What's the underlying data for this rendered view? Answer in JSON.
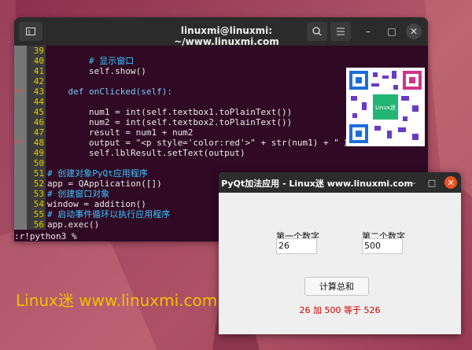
{
  "terminal": {
    "title": "linuxmi@linuxmi: ~/www.linuxmi.com",
    "lines": [
      {
        "num": "39",
        "text": "",
        "mark": ""
      },
      {
        "num": "40",
        "text": "        # 显示窗口",
        "mark": ""
      },
      {
        "num": "41",
        "text": "        self.show()",
        "mark": ""
      },
      {
        "num": "42",
        "text": "",
        "mark": ""
      },
      {
        "num": "43",
        "text": "    def onClicked(self):",
        "mark": ">>"
      },
      {
        "num": "44",
        "text": "",
        "mark": ""
      },
      {
        "num": "45",
        "text": "        num1 = int(self.textbox1.toPlainText())",
        "mark": ""
      },
      {
        "num": "46",
        "text": "        num2 = int(self.textbox2.toPlainText())",
        "mark": ""
      },
      {
        "num": "47",
        "text": "        result = num1 + num2",
        "mark": ""
      },
      {
        "num": "48",
        "text": "        output = \"<p style='color:red'>\" + str(num1) + \" 加 \" + str(num2)",
        "mark": ">>"
      },
      {
        "num": "49",
        "text": "        self.lblResult.setText(output)",
        "mark": ""
      },
      {
        "num": "50",
        "text": "",
        "mark": ""
      },
      {
        "num": "51",
        "text": "# 创建对象PyQt应用程序",
        "mark": ""
      },
      {
        "num": "52",
        "text": "app = QApplication([])",
        "mark": ""
      },
      {
        "num": "53",
        "text": "# 创建窗口对象",
        "mark": ""
      },
      {
        "num": "54",
        "text": "window = addition()",
        "mark": ""
      },
      {
        "num": "55",
        "text": "# 启动事件循环以执行应用程序",
        "mark": ""
      },
      {
        "num": "56",
        "text": "app.exec()",
        "mark": ""
      }
    ],
    "command": ":r!python3 %"
  },
  "dialog": {
    "title": "PyQt加法应用 - Linux迷 www.linuxmi.com",
    "label1": "第一个数字",
    "label2": "第二个数字",
    "value1": "26",
    "value2": "500",
    "button": "计算总和",
    "result": "26 加 500 等于 526"
  },
  "qr": {
    "center_text": "Linux迷"
  },
  "watermark": "Linux迷 www.linuxmi.com"
}
